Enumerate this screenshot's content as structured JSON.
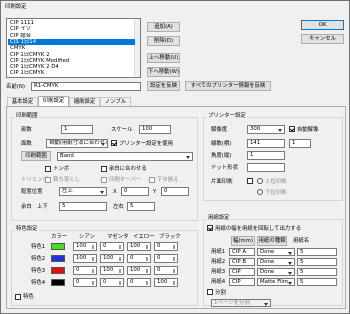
{
  "window": {
    "title": "印刷設定"
  },
  "style_list": {
    "items": [
      "CIP 1111",
      "CIP イソ",
      "CIP 結合",
      "CIS 1日14",
      "CMYK",
      "CIP 1日CMYK 2",
      "CIP 1日CMYK Modified",
      "CIP 1日CMYK 2 D4",
      "CIP 1日CMYK"
    ],
    "selected_index": 3
  },
  "buttons": {
    "add": "追加(A)",
    "delete": "削除(D)",
    "move_up": "上へ移動(U)",
    "move_down": "下へ移動(W)",
    "ok": "OK",
    "cancel": "キャンセル",
    "apply_default": "設定を反映",
    "apply_all": "すべてのプリンター情報を反映"
  },
  "name_row": {
    "label": "名前(N)",
    "value": "R1-CMYK"
  },
  "tabs": [
    "基本設定",
    "印刷設定",
    "縮刷設定",
    "ノンブル"
  ],
  "print_range": {
    "title": "印刷範囲",
    "copies_label": "部数",
    "copies_value": "1",
    "scale_label": "スケール",
    "scale_value": "100",
    "mode_label": "面数",
    "mode_value": "自動(用紙寸法に合わせる)",
    "printer_label": "プリンター設定を使用",
    "button_label": "印刷範囲",
    "range_value": "Band"
  },
  "options": {
    "tombo": "トンボ",
    "inner_margin": "余白に合わせる",
    "chord": "トリミング",
    "no_bleed": "裁ち落とし",
    "overprint": "印刷オーバー",
    "lower_left": "下ゆ揃え",
    "position_label": "配置位置",
    "position_value": "左上",
    "x_label": "X",
    "x_value": "0",
    "y_label": "Y",
    "y_value": "0",
    "margin_label": "余白",
    "top_label": "上下",
    "top_value": "5",
    "side_label": "左右",
    "side_value": "5"
  },
  "dot_settings": {
    "title": "特色設定",
    "headers": [
      "カラー",
      "シアン",
      "マゼンタ",
      "イエロー",
      "ブラック"
    ],
    "rows": [
      {
        "label": "特色1",
        "color": "#44dd22",
        "c": "100",
        "m": "0",
        "y": "100",
        "k": "0"
      },
      {
        "label": "特色2",
        "color": "#2233dd",
        "c": "100",
        "m": "100",
        "y": "0",
        "k": "0"
      },
      {
        "label": "特色3",
        "color": "#e01010",
        "c": "0",
        "m": "100",
        "y": "100",
        "k": "0"
      },
      {
        "label": "特色4",
        "color": "#000000",
        "c": "0",
        "m": "0",
        "y": "0",
        "k": "100"
      }
    ],
    "bottom_check": "特色"
  },
  "printer_settings": {
    "title": "プリンター設定",
    "res_label": "解像度",
    "res_value": "300",
    "auto_check": "自動解像",
    "screen_label": "線数(横)",
    "screen_value": "141",
    "angle_label": "角度(縦)",
    "angle_value": "1",
    "dots_label": "ドット形状",
    "dots_value": "1",
    "shape_label": "形状",
    "shape_value": "",
    "printer_side": "片面印刷",
    "radio_a": "上位印刷",
    "radio_b": "下位印刷"
  },
  "output_settings": {
    "title": "用紙設定",
    "check_label": "用紙の幅を用紙を回転して出力する",
    "tabs": [
      "幅(mm)",
      "用紙の種類",
      "用紙名"
    ],
    "rows": [
      {
        "label": "用紙1",
        "value": "CIP A",
        "type": "Done",
        "n": "5"
      },
      {
        "label": "用紙2",
        "value": "CIP B",
        "type": "Done",
        "n": "5"
      },
      {
        "label": "用紙3",
        "value": "CIP",
        "type": "Done",
        "n": "5"
      },
      {
        "label": "用紙4",
        "value": "CIP",
        "type": "Matte Film",
        "n": "5"
      }
    ],
    "bottom_check": "分割",
    "bottom_select": "1ページを分割"
  }
}
